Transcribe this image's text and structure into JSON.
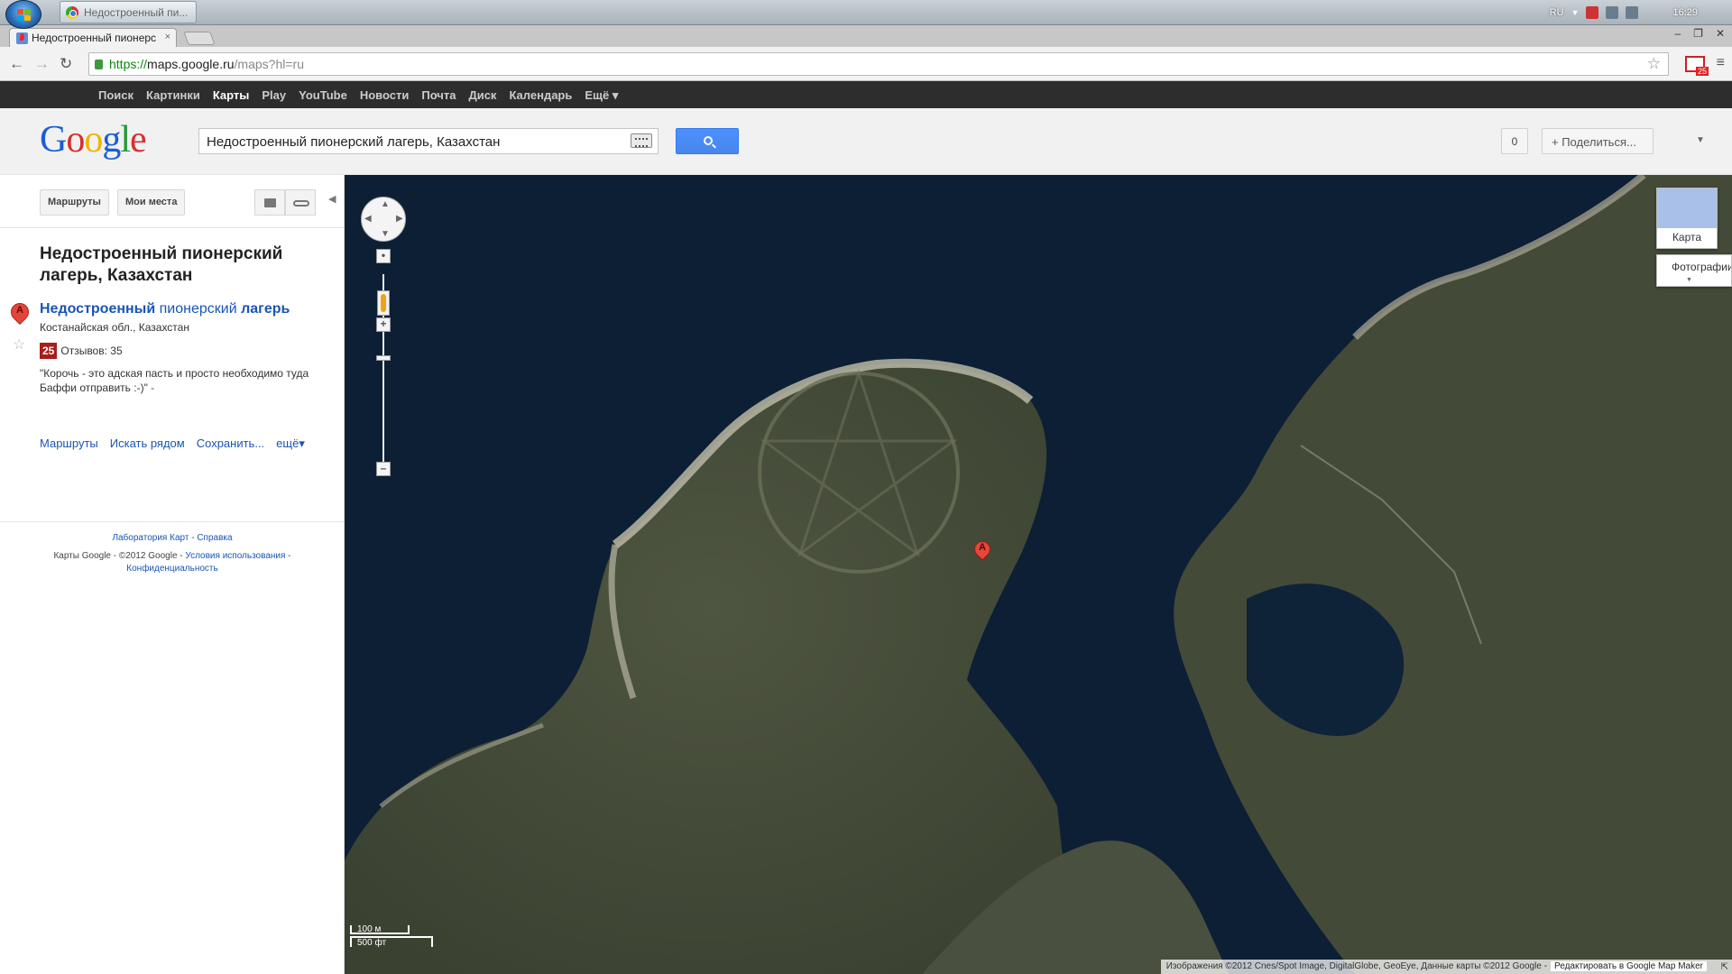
{
  "taskbar": {
    "task_title": "Недостроенный пи...",
    "language": "RU",
    "clock": "16:29"
  },
  "browser": {
    "tab_title": "Недостроенный пионерс",
    "tab_close": "×",
    "url_scheme": "https://",
    "url_host": "maps.google.ru",
    "url_path": "/maps?hl=ru",
    "mail_badge": "25",
    "window_controls": [
      "–",
      "❐",
      "✕"
    ]
  },
  "gbar": {
    "items": [
      "Поиск",
      "Картинки",
      "Карты",
      "Play",
      "YouTube",
      "Новости",
      "Почта",
      "Диск",
      "Календарь",
      "Ещё ▾"
    ],
    "active_index": 2
  },
  "header": {
    "logo_letters": [
      "G",
      "o",
      "o",
      "g",
      "l",
      "e"
    ],
    "logo_colors": [
      "#1a5dd8",
      "#d82f2f",
      "#f0b400",
      "#1a5dd8",
      "#219a37",
      "#d82f2f"
    ],
    "search_value": "Недостроенный пионерский лагерь, Казахстан",
    "count": "0",
    "share_label": "+  Поделиться..."
  },
  "leftpanel": {
    "routes_button": "Маршруты",
    "my_places_button": "Мои места",
    "heading": "Недостроенный пионерский лагерь, Казахстан",
    "marker_label": "A",
    "result_title_part1": "Недостроенный",
    "result_title_part2": " пионерский ",
    "result_title_part3": "лагерь",
    "address": "Костанайская обл., Казахстан",
    "rating_score": "25",
    "reviews": "Отзывов: 35",
    "snippet": "\"Корочь - это адская пасть и просто необходимо туда Баффи отправить :-)\"",
    "snippet_more": " -",
    "actions": [
      "Маршруты",
      "Искать рядом",
      "Сохранить...",
      "ещё▾"
    ],
    "footer_line1_a": "Лаборатория Карт",
    "footer_line1_sep": " - ",
    "footer_line1_b": "Справка",
    "footer_line2_prefix": "Карты Google - ©2012 Google - ",
    "footer_line2_terms": "Условия использования",
    "footer_line2_sep": " - ",
    "footer_line3": "Конфиденциальность"
  },
  "map": {
    "marker_label": "A",
    "maptype_map": "Карта",
    "maptype_photo": "Фотографии",
    "scale_metric": "100 м",
    "scale_imperial": "500 фт",
    "attribution": "Изображения ©2012 Cnes/Spot Image, DigitalGlobe, GeoEye, Данные карты ©2012 Google -",
    "edit_link": "Редактировать в Google Map Maker"
  }
}
